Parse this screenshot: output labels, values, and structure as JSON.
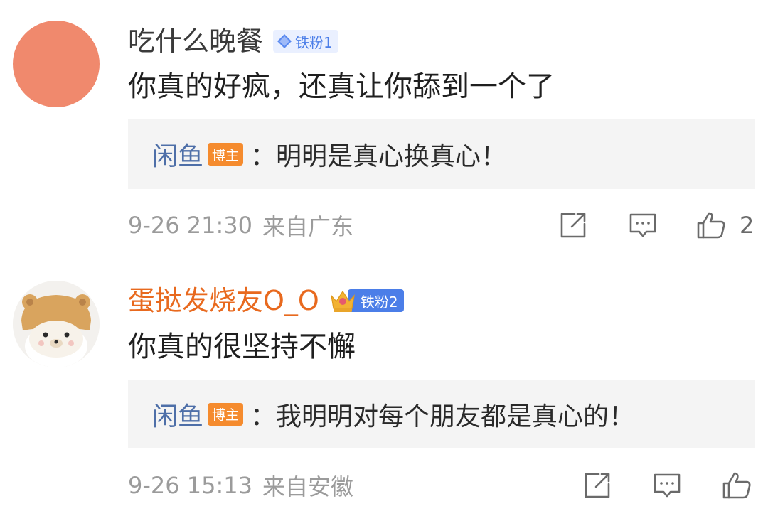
{
  "comments": [
    {
      "username": "吃什么晚餐",
      "fan_badge": "铁粉1",
      "content": "你真的好疯，还真让你舔到一个了",
      "reply": {
        "name": "闲鱼",
        "badge": "博主",
        "text": "：明明是真心换真心！"
      },
      "time": "9-26 21:30",
      "location": "来自广东",
      "like_count": "2"
    },
    {
      "username": "蛋挞发烧友O_O",
      "fan_badge": "铁粉2",
      "content": "你真的很坚持不懈",
      "reply": {
        "name": "闲鱼",
        "badge": "博主",
        "text": "：我明明对每个朋友都是真心的！"
      },
      "time": "9-26 15:13",
      "location": "来自安徽",
      "like_count": ""
    }
  ],
  "icons": {
    "share": "share-icon",
    "comment": "comment-icon",
    "like": "like-icon"
  },
  "colors": {
    "username_orange": "#e8691e",
    "reply_name_blue": "#4e6fa8",
    "blogger_badge": "#f58b2e",
    "fan_badge_blue": "#4b7ee8",
    "avatar_orange": "#f0896d",
    "meta_gray": "#9b9b9b",
    "reply_bg": "#f4f4f4"
  }
}
